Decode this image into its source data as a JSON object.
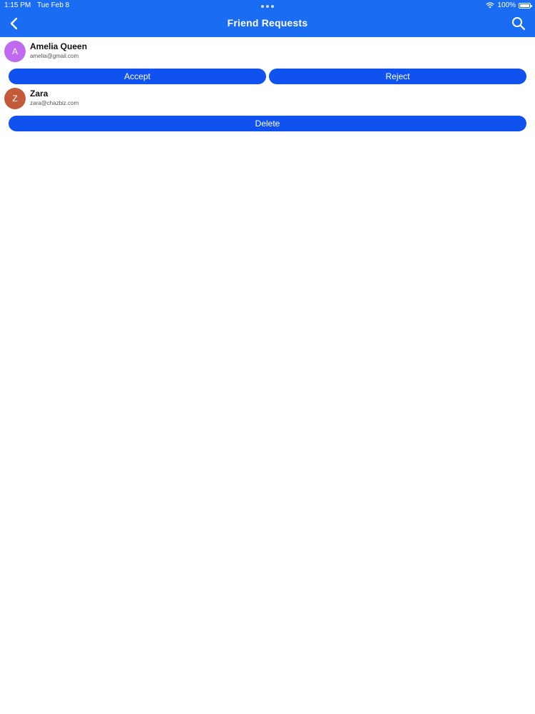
{
  "status_bar": {
    "time": "1:15 PM",
    "date": "Tue Feb 8",
    "battery": "100%"
  },
  "header": {
    "title": "Friend Requests"
  },
  "requests": [
    {
      "initial": "A",
      "name": "Amelia Queen",
      "email": "amelia@gmail.com",
      "avatar_color": "#c06af0",
      "accept_label": "Accept",
      "reject_label": "Reject"
    },
    {
      "initial": "Z",
      "name": "Zara",
      "email": "zara@chazbiz.com",
      "avatar_color": "#c35a3a",
      "delete_label": "Delete"
    }
  ],
  "colors": {
    "header_bg": "#1a6cf2",
    "button_bg": "#0f52f0"
  }
}
